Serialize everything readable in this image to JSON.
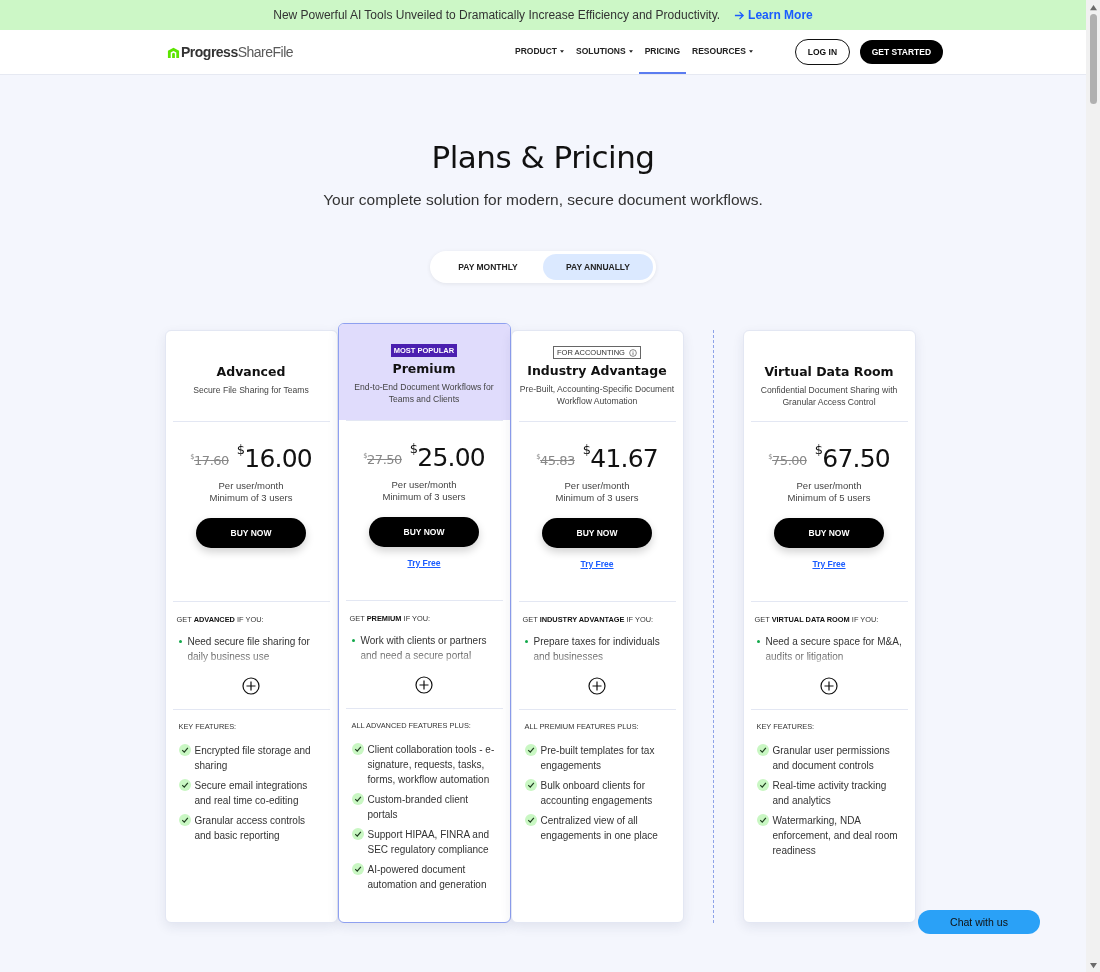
{
  "banner": {
    "text": "New Powerful AI Tools Unveiled to Dramatically Increase Efficiency and Productivity.",
    "link": "Learn More"
  },
  "nav": {
    "logo": "**Progress**ShareFile",
    "items": [
      {
        "label": "PRODUCT",
        "dropdown": true,
        "selected": false
      },
      {
        "label": "SOLUTIONS",
        "dropdown": true,
        "selected": false
      },
      {
        "label": "PRICING",
        "dropdown": false,
        "selected": true
      },
      {
        "label": "RESOURCES",
        "dropdown": true,
        "selected": false
      }
    ],
    "login": "LOG IN",
    "cta": "GET STARTED"
  },
  "hero": {
    "title": "Plans & Pricing",
    "subtitle": "Your complete solution for modern, secure document workflows."
  },
  "billing_toggle": [
    {
      "label": "PAY MONTHLY",
      "selected": false
    },
    {
      "label": "PAY ANNUALLY",
      "selected": true
    }
  ],
  "plans": [
    {
      "name": "Advanced",
      "tagline": "Secure File Sharing for Teams",
      "highlighted": false,
      "separated": false,
      "old_price": {
        "currency": "$",
        "amount": "17.60"
      },
      "price": {
        "currency": "$",
        "amount": "16.00"
      },
      "unit": "Per user/month",
      "minimum": "Minimum of 3 users",
      "buy": "BUY NOW",
      "fit_heading": "GET **ADVANCED** IF YOU:",
      "fit_points": [
        "Need secure file sharing for daily business use"
      ],
      "features_heading": "KEY FEATURES:",
      "features": [
        "Encrypted file storage and sharing",
        "Secure email integrations and real time co-editing",
        "Granular access controls and basic reporting"
      ]
    },
    {
      "badge": {
        "text": "MOST POPULAR",
        "kind": "filled"
      },
      "name": "Premium",
      "tagline": "End-to-End Document Workflows for Teams and Clients",
      "highlighted": true,
      "separated": false,
      "old_price": {
        "currency": "$",
        "amount": "27.50"
      },
      "price": {
        "currency": "$",
        "amount": "25.00"
      },
      "unit": "Per user/month",
      "minimum": "Minimum of 3 users",
      "buy": "BUY NOW",
      "try_free": "Try Free",
      "fit_heading": "GET **PREMIUM** IF YOU:",
      "fit_points": [
        "Work with clients or partners and need a secure portal"
      ],
      "features_heading": "ALL ADVANCED FEATURES PLUS:",
      "features": [
        "Client collaboration tools - e-signature, requests, tasks, forms, workflow automation",
        "Custom-branded client portals",
        "Support HIPAA, FINRA and SEC regulatory compliance",
        "AI-powered document automation and generation"
      ]
    },
    {
      "badge": {
        "text": "FOR ACCOUNTING",
        "kind": "outlined"
      },
      "name": "Industry Advantage",
      "tagline": "Pre-Built, Accounting-Specific Document Workflow Automation",
      "highlighted": false,
      "separated": false,
      "old_price": {
        "currency": "$",
        "amount": "45.83"
      },
      "price": {
        "currency": "$",
        "amount": "41.67"
      },
      "unit": "Per user/month",
      "minimum": "Minimum of 3 users",
      "buy": "BUY NOW",
      "try_free": "Try Free",
      "fit_heading": "GET **INDUSTRY ADVANTAGE** IF YOU:",
      "fit_points": [
        "Prepare taxes for individuals and businesses"
      ],
      "features_heading": "ALL PREMIUM FEATURES PLUS:",
      "features": [
        "Pre-built templates for tax engagements",
        "Bulk onboard clients for accounting engagements",
        "Centralized view of all engagements in one place"
      ]
    },
    {
      "name": "Virtual Data Room",
      "tagline": "Confidential Document Sharing with Granular Access Control",
      "highlighted": false,
      "separated": true,
      "old_price": {
        "currency": "$",
        "amount": "75.00"
      },
      "price": {
        "currency": "$",
        "amount": "67.50"
      },
      "unit": "Per user/month",
      "minimum": "Minimum of 5 users",
      "buy": "BUY NOW",
      "try_free": "Try Free",
      "fit_heading": "GET **VIRTUAL DATA ROOM** IF YOU:",
      "fit_points": [
        "Need a secure space for M&A, audits or litigation"
      ],
      "features_heading": "KEY FEATURES:",
      "features": [
        "Granular user permissions and document controls",
        "Real-time activity tracking and analytics",
        "Watermarking, NDA enforcement, and deal room readiness"
      ]
    }
  ],
  "chat": "Chat with us"
}
